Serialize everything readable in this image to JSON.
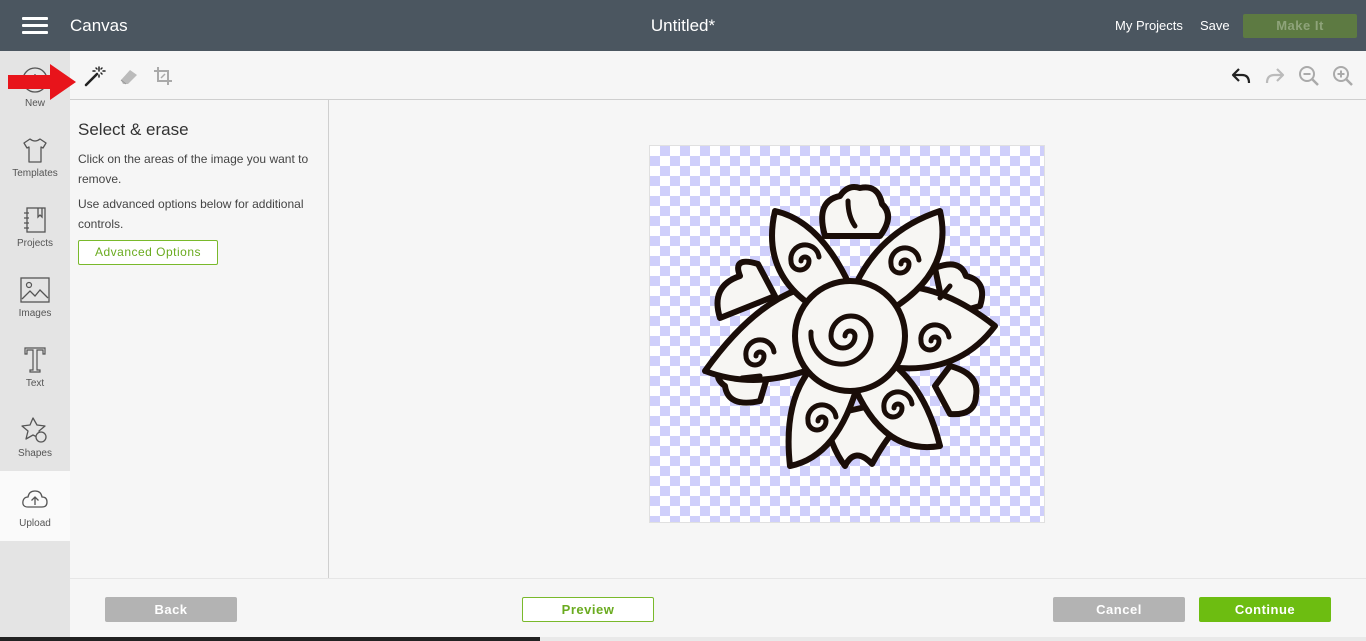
{
  "header": {
    "app_title": "Canvas",
    "doc_title": "Untitled*",
    "my_projects": "My Projects",
    "save": "Save",
    "make_it": "Make It"
  },
  "sidebar": {
    "items": [
      {
        "label": "New",
        "icon": "plus-circle-icon"
      },
      {
        "label": "Templates",
        "icon": "tshirt-icon"
      },
      {
        "label": "Projects",
        "icon": "notebook-icon"
      },
      {
        "label": "Images",
        "icon": "image-icon"
      },
      {
        "label": "Text",
        "icon": "text-icon"
      },
      {
        "label": "Shapes",
        "icon": "shapes-icon"
      },
      {
        "label": "Upload",
        "icon": "cloud-upload-icon"
      }
    ]
  },
  "toolbar": {
    "left_tools": [
      "magic-wand-icon",
      "eraser-icon",
      "crop-icon"
    ],
    "right_tools": [
      "undo-icon",
      "redo-icon",
      "zoom-out-icon",
      "zoom-in-icon"
    ]
  },
  "panel": {
    "title": "Select & erase",
    "text1": "Click on the areas of the image you want to remove.",
    "text2": "Use advanced options below for additional controls.",
    "advanced_options": "Advanced Options"
  },
  "footer": {
    "back": "Back",
    "preview": "Preview",
    "cancel": "Cancel",
    "continue": "Continue"
  },
  "colors": {
    "header_bg": "#4b5660",
    "accent_green": "#6dbd11",
    "arrow_red": "#e8141b",
    "checker": "#cfcffb"
  }
}
